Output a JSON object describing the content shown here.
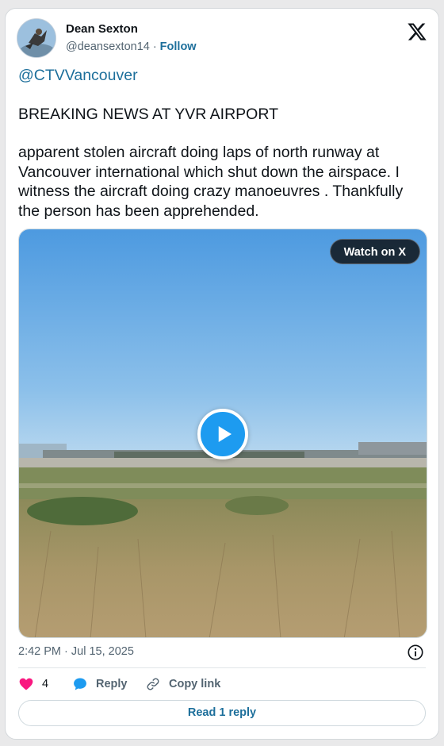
{
  "author": {
    "name": "Dean Sexton",
    "handle": "@deansexton14",
    "separator": "·",
    "follow_label": "Follow"
  },
  "tweet": {
    "mention": "@CTVVancouver",
    "headline": "BREAKING NEWS AT YVR AIRPORT",
    "body": "apparent stolen aircraft doing laps of north runway at Vancouver international which shut down the airspace. I witness the aircraft doing crazy manoeuvres . Thankfully the person has been apprehended."
  },
  "media": {
    "watch_label": "Watch on X",
    "play_icon": "play-icon"
  },
  "timestamp": "2:42 PM · Jul 15, 2025",
  "actions": {
    "like_count": "4",
    "reply_label": "Reply",
    "copy_link_label": "Copy link"
  },
  "read_reply_label": "Read 1 reply",
  "colors": {
    "link": "#1d6f9b",
    "play_button": "#1d9bf0",
    "heart": "#f91880",
    "text_secondary": "#536471"
  }
}
